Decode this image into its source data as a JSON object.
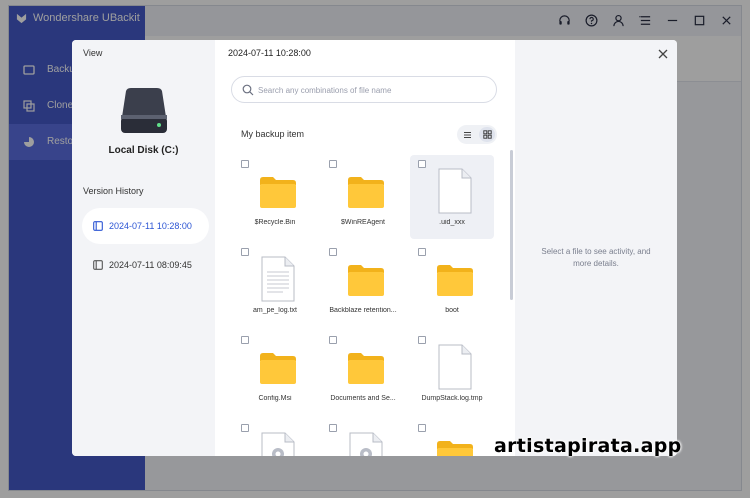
{
  "app": {
    "title": "Wondershare UBackit",
    "nav": [
      {
        "label": "Backup",
        "icon": "backup-icon",
        "active": false
      },
      {
        "label": "Clone",
        "icon": "clone-icon",
        "active": false
      },
      {
        "label": "Restore",
        "icon": "restore-icon",
        "active": true
      }
    ],
    "titlebar_icons": [
      "headset-icon",
      "help-icon",
      "user-icon",
      "menu-icon",
      "minimize-icon",
      "maximize-icon",
      "close-icon"
    ]
  },
  "dialog": {
    "view_label": "View",
    "disk_label": "Local Disk (C:)",
    "version_history_title": "Version History",
    "versions": [
      {
        "label": "2024-07-11 10:28:00",
        "active": true
      },
      {
        "label": "2024-07-11 08:09:45",
        "active": false
      }
    ],
    "current_version": "2024-07-11 10:28:00",
    "search": {
      "placeholder": "Search any combinations of file name",
      "value": ""
    },
    "backup_item_label": "My backup item",
    "view_mode": "grid",
    "files": [
      {
        "name": "$Recycle.Bin",
        "type": "folder",
        "selected": false
      },
      {
        "name": "$WinREAgent",
        "type": "folder",
        "selected": false
      },
      {
        "name": ".uid_xxx",
        "type": "file",
        "selected": true
      },
      {
        "name": "am_pe_log.txt",
        "type": "text",
        "selected": false
      },
      {
        "name": "Backblaze retention...",
        "type": "folder",
        "selected": false
      },
      {
        "name": "boot",
        "type": "folder",
        "selected": false
      },
      {
        "name": "Config.Msi",
        "type": "folder",
        "selected": false
      },
      {
        "name": "Documents and Se...",
        "type": "folder",
        "selected": false
      },
      {
        "name": "DumpStack.log.tmp",
        "type": "file",
        "selected": false
      },
      {
        "name": "",
        "type": "settings-file",
        "selected": false
      },
      {
        "name": "",
        "type": "settings-file",
        "selected": false
      },
      {
        "name": "",
        "type": "folder",
        "selected": false
      }
    ],
    "details_hint": "Select a file to see activity, and more details."
  },
  "colors": {
    "sidebar": "#4459c9",
    "accent": "#2c55d4",
    "folder": "#ffc83a",
    "folder_tab": "#f2b21b"
  },
  "watermark": "artistapirata.app"
}
